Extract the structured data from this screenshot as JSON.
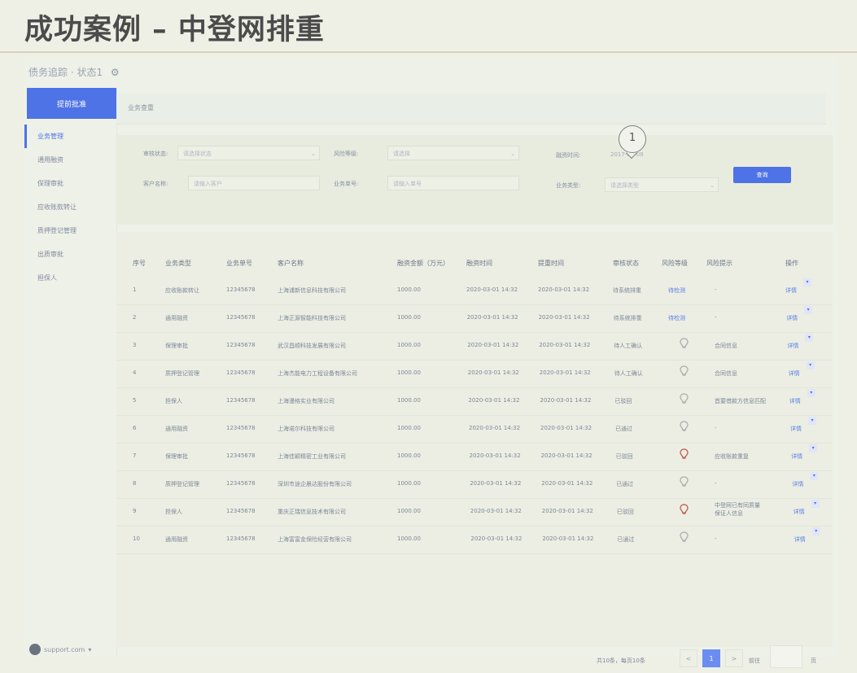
{
  "slide": {
    "title": "成功案例 – 中登网排重"
  },
  "app": {
    "header": {
      "title": "债务追踪 · 状态1",
      "gear_icon": "gear-icon"
    },
    "sidebar": {
      "top_label": "提前批准",
      "items": [
        {
          "label": "业务管理"
        },
        {
          "label": "通用融资"
        },
        {
          "label": "保理审批"
        },
        {
          "label": "应收账款转让"
        },
        {
          "label": "质押登记管理"
        },
        {
          "label": "出质审批"
        },
        {
          "label": "担保人"
        }
      ],
      "account": "support.com"
    },
    "topbar": {
      "label": "业务查重"
    },
    "filters": {
      "status_label": "审核状态:",
      "status_placeholder": "请选择状态",
      "risk_label": "风险等级:",
      "risk_placeholder": "请选择",
      "time_label": "融资时间:",
      "time_value": "2017-05-08",
      "client_label": "客户名称:",
      "client_placeholder": "请输入客户",
      "biz_no_label": "业务单号:",
      "biz_no_placeholder": "请输入单号",
      "biz_type_label": "业务类型:",
      "biz_type_placeholder": "请选择类型",
      "search_button": "查询",
      "pin_number": "1"
    },
    "table": {
      "headers": [
        "序号",
        "业务类型",
        "业务单号",
        "客户名称",
        "融资金额（万元）",
        "融资时间",
        "提重时间",
        "审核状态",
        "风险等级",
        "风险提示",
        "操作"
      ],
      "rows": [
        {
          "no": "1",
          "type": "应收账款转让",
          "code": "12345678",
          "client": "上海浦新信息科技有限公司",
          "amount": "1000.00",
          "t1": "2020-03-01  14:32",
          "t2": "2020-03-01  14:32",
          "status": "待系统排重",
          "risk": "待检测",
          "risk_kind": "text",
          "tip": "-",
          "op": "详情"
        },
        {
          "no": "2",
          "type": "通用融资",
          "code": "12345678",
          "client": "上海正源智能科技有限公司",
          "amount": "1000.00",
          "t1": "2020-03-01  14:32",
          "t2": "2020-03-01  14:32",
          "status": "待系统排重",
          "risk": "待检测",
          "risk_kind": "text",
          "tip": "-",
          "op": "详情"
        },
        {
          "no": "3",
          "type": "保理审批",
          "code": "12345678",
          "client": "武汉昌顺科技发展有限公司",
          "amount": "1000.00",
          "t1": "2020-03-01  14:32",
          "t2": "2020-03-01  14:32",
          "status": "待人工确认",
          "risk": "",
          "risk_kind": "grey",
          "tip": "合同信息",
          "op": "详情"
        },
        {
          "no": "4",
          "type": "质押登记管理",
          "code": "12345678",
          "client": "上海杰能电力工程设备有限公司",
          "amount": "1000.00",
          "t1": "2020-03-01  14:32",
          "t2": "2020-03-01  14:32",
          "status": "待人工确认",
          "risk": "",
          "risk_kind": "grey",
          "tip": "合同信息",
          "op": "详情"
        },
        {
          "no": "5",
          "type": "担保人",
          "code": "12345678",
          "client": "上海漫格实业有限公司",
          "amount": "1000.00",
          "t1": "2020-03-01  14:32",
          "t2": "2020-03-01  14:32",
          "status": "已驳回",
          "risk": "",
          "risk_kind": "grey",
          "tip": "首要借款方信息匹配",
          "op": "详情"
        },
        {
          "no": "6",
          "type": "通用融资",
          "code": "12345678",
          "client": "上海诺尔科技有限公司",
          "amount": "1000.00",
          "t1": "2020-03-01  14:32",
          "t2": "2020-03-01  14:32",
          "status": "已通过",
          "risk": "",
          "risk_kind": "grey",
          "tip": "-",
          "op": "详情"
        },
        {
          "no": "7",
          "type": "保理审批",
          "code": "12345678",
          "client": "上海佳颖精密工业有限公司",
          "amount": "1000.00",
          "t1": "2020-03-01  14:32",
          "t2": "2020-03-01  14:32",
          "status": "已驳回",
          "risk": "",
          "risk_kind": "red",
          "tip": "应收账款重复",
          "op": "详情"
        },
        {
          "no": "8",
          "type": "质押登记管理",
          "code": "12345678",
          "client": "深圳市途企晨达股份有限公司",
          "amount": "1000.00",
          "t1": "2020-03-01  14:32",
          "t2": "2020-03-01  14:32",
          "status": "已通过",
          "risk": "",
          "risk_kind": "grey",
          "tip": "-",
          "op": "详情"
        },
        {
          "no": "9",
          "type": "担保人",
          "code": "12345678",
          "client": "重庆正瑞信息技术有限公司",
          "amount": "1000.00",
          "t1": "2020-03-01  14:32",
          "t2": "2020-03-01  14:32",
          "status": "已驳回",
          "risk": "",
          "risk_kind": "red",
          "tip": "中登网已有同质量\n保证人信息",
          "op": "详情"
        },
        {
          "no": "10",
          "type": "通用融资",
          "code": "12345678",
          "client": "上海富富金保险经营有限公司",
          "amount": "1000.00",
          "t1": "2020-03-01  14:32",
          "t2": "2020-03-01  14:32",
          "status": "已通过",
          "risk": "",
          "risk_kind": "grey",
          "tip": "-",
          "op": "详情"
        }
      ]
    },
    "pagination": {
      "summary": "共10条，每页10条",
      "prev": "<",
      "current": "1",
      "next": ">",
      "goto_label": "前往",
      "page_suffix": "页"
    }
  },
  "colors": {
    "accent": "#4e73e6",
    "bulb_red": "#c0544a",
    "bulb_grey": "#a8aca8"
  }
}
